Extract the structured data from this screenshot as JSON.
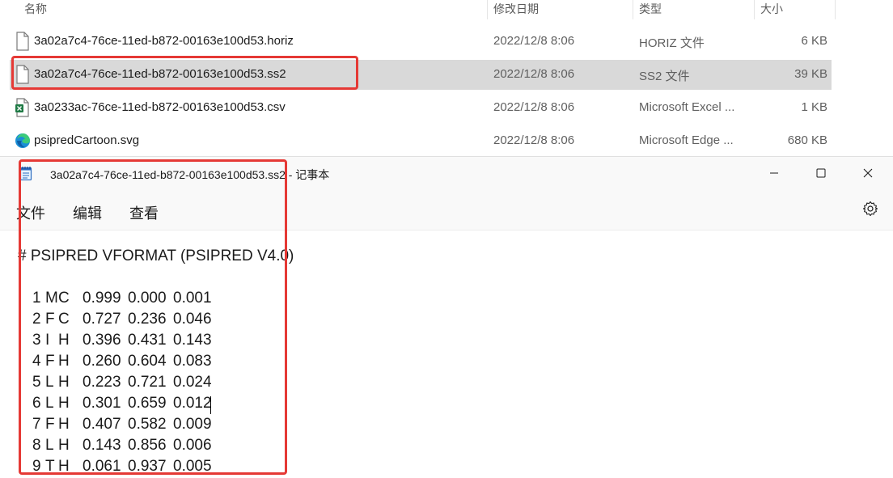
{
  "explorer": {
    "columns": {
      "name": "名称",
      "modified": "修改日期",
      "type": "类型",
      "size": "大小"
    },
    "files": [
      {
        "name": "3a02a7c4-76ce-11ed-b872-00163e100d53.horiz",
        "modified": "2022/12/8 8:06",
        "type": "HORIZ 文件",
        "size": "6 KB",
        "icon": "blank-file-icon"
      },
      {
        "name": "3a02a7c4-76ce-11ed-b872-00163e100d53.ss2",
        "modified": "2022/12/8 8:06",
        "type": "SS2 文件",
        "size": "39 KB",
        "icon": "blank-file-icon",
        "selected": true
      },
      {
        "name": "3a0233ac-76ce-11ed-b872-00163e100d53.csv",
        "modified": "2022/12/8 8:06",
        "type": "Microsoft Excel ...",
        "size": "1 KB",
        "icon": "excel-csv-icon"
      },
      {
        "name": "psipredCartoon.svg",
        "modified": "2022/12/8 8:06",
        "type": "Microsoft Edge ...",
        "size": "680 KB",
        "icon": "edge-svg-icon"
      }
    ]
  },
  "notepad": {
    "title": "3a02a7c4-76ce-11ed-b872-00163e100d53.ss2 - 记事本",
    "menu": {
      "file": "文件",
      "edit": "编辑",
      "view": "查看"
    },
    "header_line": "# PSIPRED VFORMAT (PSIPRED V4.0)",
    "rows": [
      {
        "num": "1",
        "aa": "M",
        "ss": "C",
        "c": "0.999",
        "h": "0.000",
        "e": "0.001"
      },
      {
        "num": "2",
        "aa": "F",
        "ss": "C",
        "c": "0.727",
        "h": "0.236",
        "e": "0.046"
      },
      {
        "num": "3",
        "aa": "I",
        "ss": "H",
        "c": "0.396",
        "h": "0.431",
        "e": "0.143"
      },
      {
        "num": "4",
        "aa": "F",
        "ss": "H",
        "c": "0.260",
        "h": "0.604",
        "e": "0.083"
      },
      {
        "num": "5",
        "aa": "L",
        "ss": "H",
        "c": "0.223",
        "h": "0.721",
        "e": "0.024"
      },
      {
        "num": "6",
        "aa": "L",
        "ss": "H",
        "c": "0.301",
        "h": "0.659",
        "e": "0.012"
      },
      {
        "num": "7",
        "aa": "F",
        "ss": "H",
        "c": "0.407",
        "h": "0.582",
        "e": "0.009"
      },
      {
        "num": "8",
        "aa": "L",
        "ss": "H",
        "c": "0.143",
        "h": "0.856",
        "e": "0.006"
      },
      {
        "num": "9",
        "aa": "T",
        "ss": "H",
        "c": "0.061",
        "h": "0.937",
        "e": "0.005"
      }
    ]
  },
  "colors": {
    "annotation": "#e53935",
    "selection": "#d9d9d9"
  }
}
